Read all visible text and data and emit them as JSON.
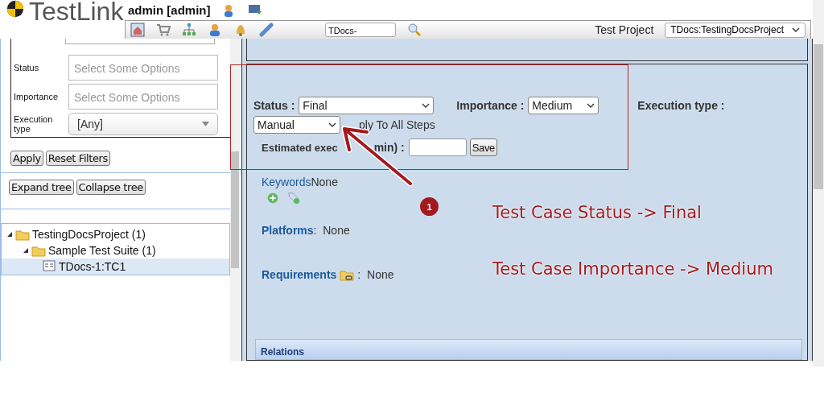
{
  "header": {
    "logo": "TestLink",
    "user": "admin [admin]",
    "search_value": "TDocs-",
    "project_label": "Test Project",
    "project_value": "TDocs:TestingDocsProject"
  },
  "filters": {
    "fields": [
      {
        "kind": "multiselect",
        "label": "Status",
        "placeholder": "Select Some Options"
      },
      {
        "kind": "multiselect",
        "label": "Importance",
        "placeholder": "Select Some Options"
      },
      {
        "kind": "select",
        "label": "Execution type",
        "value": "[Any]"
      }
    ],
    "buttons": [
      "Apply",
      "Reset Filters"
    ]
  },
  "tree_buttons": [
    "Expand tree",
    "Collapse tree"
  ],
  "tree": [
    {
      "label": "TestingDocsProject (1)",
      "kind": "folder",
      "expanded": true,
      "selected": false,
      "children": [
        {
          "label": "Sample Test Suite (1)",
          "kind": "folder",
          "expanded": true,
          "selected": false,
          "children": [
            {
              "label": "TDocs-1:TC1",
              "kind": "testcase",
              "selected": true
            }
          ]
        }
      ]
    }
  ],
  "testcase": {
    "status_label": "Status :",
    "status_value": "Final",
    "importance_label": "Importance :",
    "importance_value": "Medium",
    "execution_label": "Execution type :",
    "execution_value": "Manual",
    "apply_steps_text": "ply To All Steps",
    "estimated_label_start": "Estimated exec",
    "estimated_label_end": "min) :",
    "save_button": "Save",
    "keywords_label": "Keywords",
    "keywords_value": "None",
    "platforms_label": "Platforms",
    "platforms_value": ":  None",
    "requirements_label": "Requirements",
    "requirements_value": ":  None",
    "relations_title": "Relations"
  },
  "annotations": {
    "badge": "1",
    "notes": [
      "Test Case Status -> Final",
      "Test Case Importance -> Medium"
    ]
  }
}
